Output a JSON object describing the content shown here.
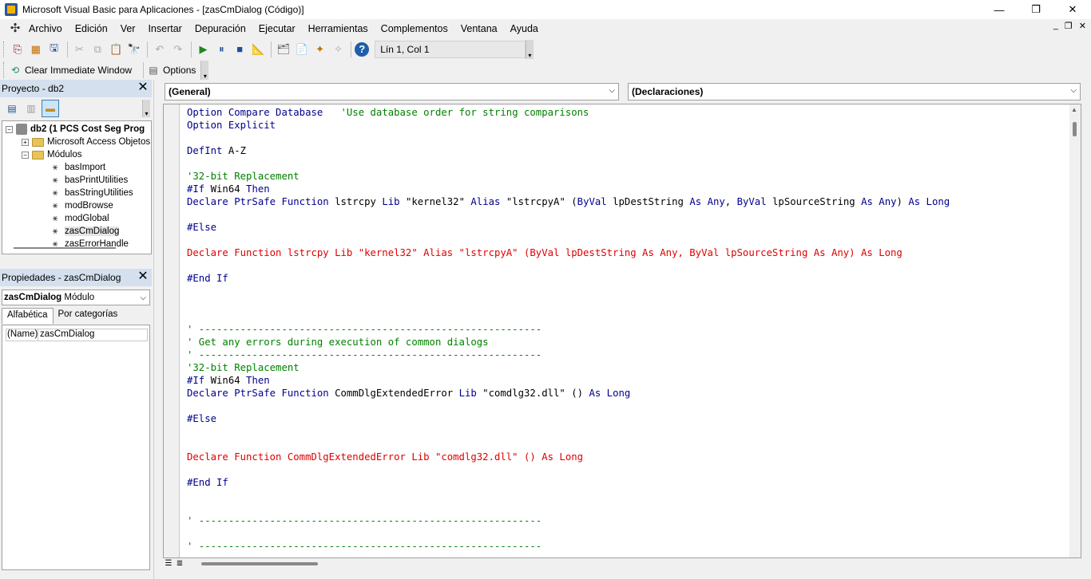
{
  "window": {
    "title": "Microsoft Visual Basic para Aplicaciones - [zasCmDialog (Código)]",
    "minimize": "—",
    "maximize": "❐",
    "close": "✕"
  },
  "menu": {
    "items": [
      "Archivo",
      "Edición",
      "Ver",
      "Insertar",
      "Depuración",
      "Ejecutar",
      "Herramientas",
      "Complementos",
      "Ventana",
      "Ayuda"
    ],
    "mdi_minimize": "_",
    "mdi_restore": "❐",
    "mdi_close": "✕"
  },
  "toolbar": {
    "position": "Lín 1, Col 1"
  },
  "toolbar2": {
    "clear_immediate": "Clear Immediate Window",
    "options": "Options"
  },
  "project": {
    "title": "Proyecto - db2",
    "root": "db2 (1 PCS Cost Seg Prog",
    "access_objects": "Microsoft Access Objetos de",
    "modules_folder": "Módulos",
    "modules": [
      "basImport",
      "basPrintUtilities",
      "basStringUtilities",
      "modBrowse",
      "modGlobal",
      "zasCmDialog",
      "zasErrorHandle"
    ],
    "selected_module": "zasCmDialog"
  },
  "properties": {
    "title": "Propiedades - zasCmDialog",
    "object_name": "zasCmDialog",
    "object_type": "Módulo",
    "tab_alpha": "Alfabética",
    "tab_category": "Por categorías",
    "row_name": "(Name)",
    "row_value": "zasCmDialog"
  },
  "editor": {
    "object_combo": "(General)",
    "proc_combo": "(Declaraciones)",
    "lines": [
      {
        "t": 0,
        "segs": [
          [
            "kw",
            "Option Compare Database"
          ],
          [
            "n",
            "   "
          ],
          [
            "cm",
            "'Use database order for string comparisons"
          ]
        ]
      },
      {
        "t": 1,
        "segs": [
          [
            "kw",
            "Option Explicit"
          ]
        ]
      },
      {
        "t": 3,
        "segs": [
          [
            "kw",
            "DefInt"
          ],
          [
            "n",
            " A-Z"
          ]
        ]
      },
      {
        "t": 5,
        "segs": [
          [
            "cm",
            "'32-bit Replacement"
          ]
        ]
      },
      {
        "t": 6,
        "segs": [
          [
            "kw",
            "#If"
          ],
          [
            "n",
            " Win64 "
          ],
          [
            "kw",
            "Then"
          ]
        ]
      },
      {
        "t": 7,
        "segs": [
          [
            "kw",
            "Declare PtrSafe Function"
          ],
          [
            "n",
            " lstrcpy "
          ],
          [
            "kw",
            "Lib"
          ],
          [
            "n",
            " \"kernel32\" "
          ],
          [
            "kw",
            "Alias"
          ],
          [
            "n",
            " \"lstrcpyA\" ("
          ],
          [
            "kw",
            "ByVal"
          ],
          [
            "n",
            " lpDestString "
          ],
          [
            "kw",
            "As Any"
          ],
          [
            "n",
            ", "
          ],
          [
            "kw",
            "ByVal"
          ],
          [
            "n",
            " lpSourceString "
          ],
          [
            "kw",
            "As Any"
          ],
          [
            "n",
            ") "
          ],
          [
            "kw",
            "As Long"
          ]
        ]
      },
      {
        "t": 9,
        "segs": [
          [
            "kw",
            "#Else"
          ]
        ]
      },
      {
        "t": 11,
        "segs": [
          [
            "err",
            "Declare Function lstrcpy Lib \"kernel32\" Alias \"lstrcpyA\" (ByVal lpDestString As Any, ByVal lpSourceString As Any) As Long"
          ]
        ]
      },
      {
        "t": 13,
        "segs": [
          [
            "kw",
            "#End If"
          ]
        ]
      },
      {
        "t": 17,
        "segs": [
          [
            "cm",
            "' ----------------------------------------------------------"
          ]
        ]
      },
      {
        "t": 18,
        "segs": [
          [
            "cm",
            "' Get any errors during execution of common dialogs"
          ]
        ]
      },
      {
        "t": 19,
        "segs": [
          [
            "cm",
            "' ----------------------------------------------------------"
          ]
        ]
      },
      {
        "t": 20,
        "segs": [
          [
            "cm",
            "'32-bit Replacement"
          ]
        ]
      },
      {
        "t": 21,
        "segs": [
          [
            "kw",
            "#If"
          ],
          [
            "n",
            " Win64 "
          ],
          [
            "kw",
            "Then"
          ]
        ]
      },
      {
        "t": 22,
        "segs": [
          [
            "kw",
            "Declare PtrSafe Function"
          ],
          [
            "n",
            " CommDlgExtendedError "
          ],
          [
            "kw",
            "Lib"
          ],
          [
            "n",
            " \"comdlg32.dll\" () "
          ],
          [
            "kw",
            "As Long"
          ]
        ]
      },
      {
        "t": 24,
        "segs": [
          [
            "kw",
            "#Else"
          ]
        ]
      },
      {
        "t": 27,
        "segs": [
          [
            "err",
            "Declare Function CommDlgExtendedError Lib \"comdlg32.dll\" () As Long"
          ]
        ]
      },
      {
        "t": 29,
        "segs": [
          [
            "kw",
            "#End If"
          ]
        ]
      },
      {
        "t": 32,
        "segs": [
          [
            "cm",
            "' ----------------------------------------------------------"
          ]
        ]
      },
      {
        "t": 34,
        "segs": [
          [
            "cm",
            "' ----------------------------------------------------------"
          ]
        ]
      }
    ]
  }
}
